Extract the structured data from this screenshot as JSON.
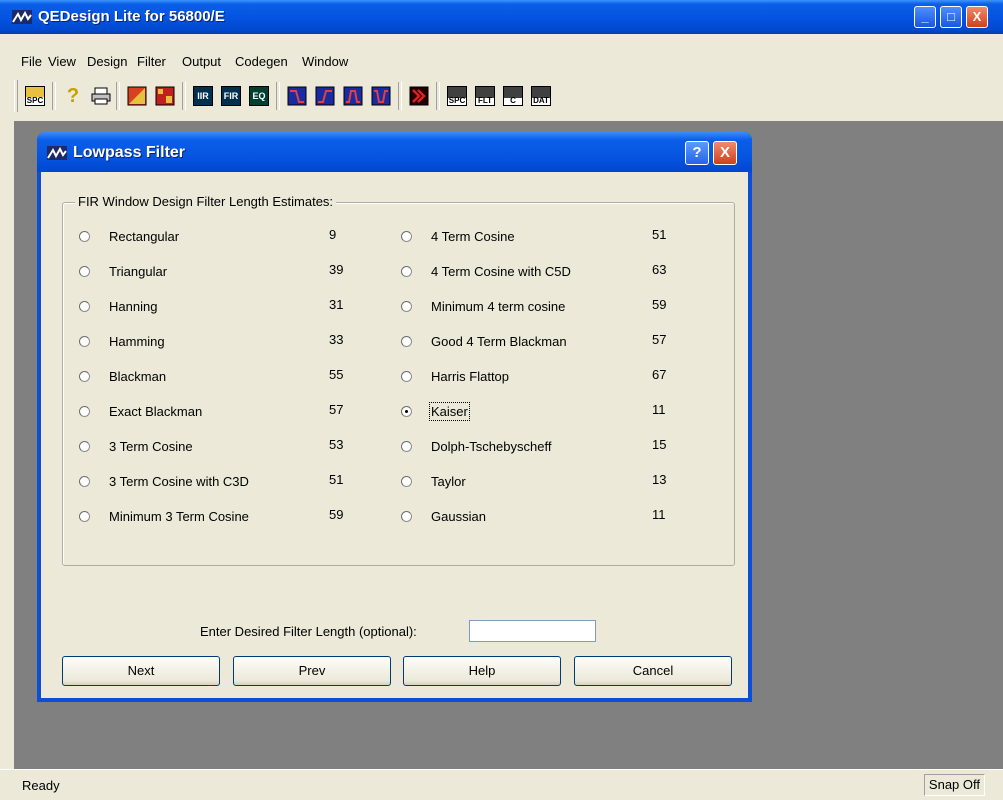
{
  "app": {
    "title": "QEDesign Lite for 56800/E",
    "min_glyph": "_",
    "max_glyph": "□",
    "close_glyph": "X"
  },
  "menu": [
    "File",
    "View",
    "Design",
    "Filter",
    "Output",
    "Codegen",
    "Window"
  ],
  "toolbar": {
    "open_spc_label": "SPC",
    "iir_label": "IIR",
    "fir_label": "FIR",
    "eq_label": "EQ",
    "save_spc_label": "SPC",
    "save_flt_label": "FLT",
    "save_c_label": "C",
    "save_dat_label": "DAT"
  },
  "dialog": {
    "title": "Lowpass Filter",
    "help_glyph": "?",
    "close_glyph": "X",
    "group_caption": "FIR Window Design Filter Length Estimates:",
    "left_options": [
      {
        "label": "Rectangular",
        "value": "9"
      },
      {
        "label": "Triangular",
        "value": "39"
      },
      {
        "label": "Hanning",
        "value": "31"
      },
      {
        "label": "Hamming",
        "value": "33"
      },
      {
        "label": "Blackman",
        "value": "55"
      },
      {
        "label": "Exact Blackman",
        "value": "57"
      },
      {
        "label": "3 Term Cosine",
        "value": "53"
      },
      {
        "label": "3 Term Cosine with C3D",
        "value": "51"
      },
      {
        "label": "Minimum 3 Term Cosine",
        "value": "59"
      }
    ],
    "right_options": [
      {
        "label": "4 Term Cosine",
        "value": "51"
      },
      {
        "label": "4 Term Cosine with C5D",
        "value": "63"
      },
      {
        "label": "Minimum 4 term cosine",
        "value": "59"
      },
      {
        "label": "Good 4 Term Blackman",
        "value": "57"
      },
      {
        "label": "Harris Flattop",
        "value": "67"
      },
      {
        "label": "Kaiser",
        "value": "11"
      },
      {
        "label": "Dolph-Tschebyscheff",
        "value": "15"
      },
      {
        "label": "Taylor",
        "value": "13"
      },
      {
        "label": "Gaussian",
        "value": "11"
      }
    ],
    "selected": "Kaiser",
    "desired_length_label": "Enter Desired Filter Length (optional):",
    "desired_length_value": "",
    "buttons": {
      "next": "Next",
      "prev": "Prev",
      "help": "Help",
      "cancel": "Cancel"
    }
  },
  "status": {
    "text": "Ready",
    "snap": "Snap Off"
  }
}
